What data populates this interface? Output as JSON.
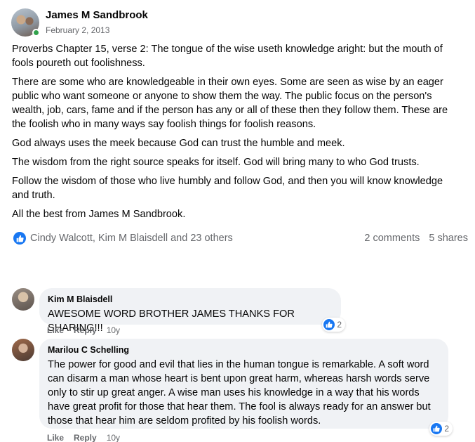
{
  "post": {
    "author": "James M Sandbrook",
    "date": "February 2, 2013",
    "paragraphs": [
      "Proverbs Chapter 15, verse 2: The tongue of the wise useth knowledge aright: but the mouth of fools poureth out foolishness.",
      "There are some who are knowledgeable in their own eyes. Some are seen as wise by an eager public who want someone or anyone to show them the way. The public focus on the person's wealth, job,  cars, fame and if the person has any or all of these then they follow them. These are the foolish who in many ways say foolish things for foolish reasons.",
      "God always uses the meek because God can trust the humble and meek.",
      "The wisdom from the right source speaks for itself. God will bring many to who God trusts.",
      "Follow the wisdom of those who live humbly and follow God, and then you will know knowledge and truth.",
      "All the best from James M Sandbrook."
    ],
    "reactions": {
      "icon": "like-icon",
      "names": "Cindy Walcott, Kim M Blaisdell and 23 others",
      "comments": "2 comments",
      "shares": "5 shares"
    }
  },
  "comments": [
    {
      "author": "Kim M Blaisdell",
      "text": "AWESOME WORD BROTHER JAMES THANKS FOR SHARING!!!",
      "reaction_count": "2",
      "like_label": "Like",
      "reply_label": "Reply",
      "age": "10y"
    },
    {
      "author": "Marilou C Schelling",
      "text": "The power for good and evil that lies in the human tongue is remarkable. A soft word can disarm a man whose heart is bent upon great harm, whereas harsh words serve only to stir up great anger. A wise man uses his knowledge in a way that his words have great profit for those that hear them. The fool is always ready for an answer but those that hear him are seldom profited by his foolish words.",
      "reaction_count": "2",
      "like_label": "Like",
      "reply_label": "Reply",
      "age": "10y"
    }
  ],
  "colors": {
    "accent": "#1877f2",
    "online": "#31a24c",
    "bubble": "#f0f2f5",
    "secondary_text": "#65676b"
  }
}
